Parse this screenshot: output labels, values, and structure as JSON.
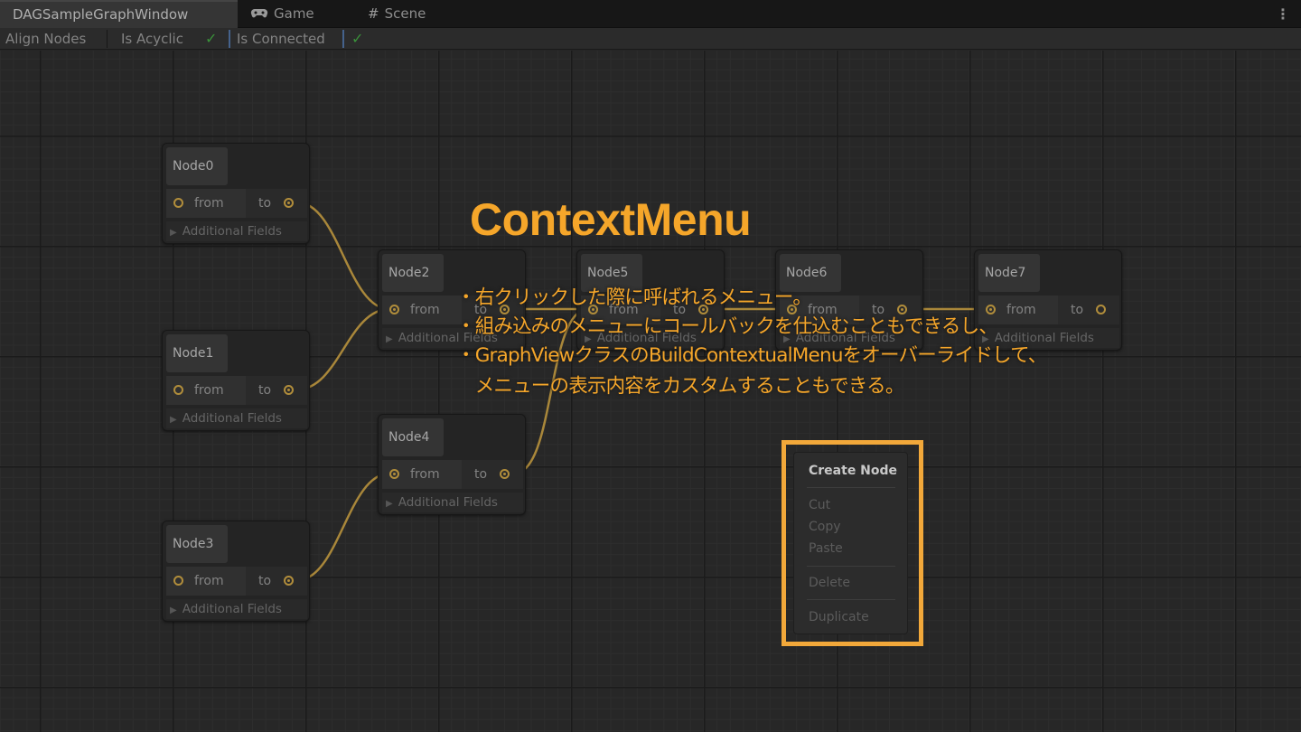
{
  "tabs": [
    {
      "label": "DAGSampleGraphWindow",
      "icon": ""
    },
    {
      "label": "Game",
      "icon": "gamepad-icon"
    },
    {
      "label": "Scene",
      "icon": "hash-icon"
    }
  ],
  "tab_more_icon": "kebab-menu-icon",
  "toolbar": {
    "align_nodes": "Align Nodes",
    "is_acyclic": "Is Acyclic",
    "is_acyclic_checked": true,
    "is_connected": "Is Connected",
    "is_connected_checked": true
  },
  "nodes": [
    {
      "title": "Node0",
      "from": "from",
      "to": "to",
      "extra": "Additional Fields"
    },
    {
      "title": "Node1",
      "from": "from",
      "to": "to",
      "extra": "Additional Fields"
    },
    {
      "title": "Node2",
      "from": "from",
      "to": "to",
      "extra": "Additional Fields"
    },
    {
      "title": "Node3",
      "from": "from",
      "to": "to",
      "extra": "Additional Fields"
    },
    {
      "title": "Node4",
      "from": "from",
      "to": "to",
      "extra": "Additional Fields"
    },
    {
      "title": "Node5",
      "from": "from",
      "to": "to",
      "extra": "Additional Fields"
    },
    {
      "title": "Node6",
      "from": "from",
      "to": "to",
      "extra": "Additional Fields"
    },
    {
      "title": "Node7",
      "from": "from",
      "to": "to",
      "extra": "Additional Fields"
    }
  ],
  "context_menu": {
    "items": [
      "Create Node",
      "Cut",
      "Copy",
      "Paste",
      "Delete",
      "Duplicate"
    ]
  },
  "overlay": {
    "title": "ContextMenu",
    "lines": [
      "・右クリックした際に呼ばれるメニュー。",
      "・組み込みのメニューにコールバックを仕込むこともできるし、",
      "・GraphViewクラスのBuildContextualMenuをオーバーライドして、",
      "　メニューの表示内容をカスタムすることもできる。"
    ]
  },
  "colors": {
    "accent": "#f5a62a",
    "edge": "#b8933f",
    "check": "#3f9f3f"
  }
}
